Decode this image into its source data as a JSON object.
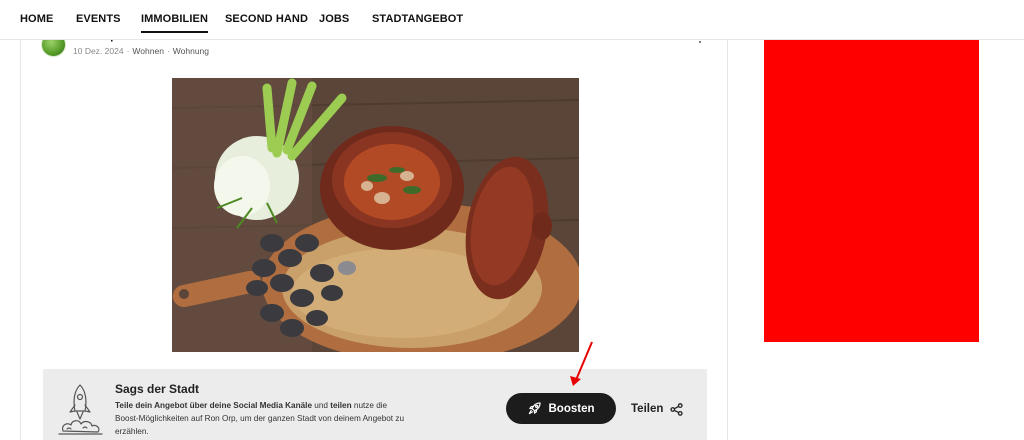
{
  "nav": {
    "items": [
      {
        "label": "HOME"
      },
      {
        "label": "EVENTS"
      },
      {
        "label": "IMMOBILIEN"
      },
      {
        "label": "SECOND HAND"
      },
      {
        "label": "JOBS"
      },
      {
        "label": "STADTANGEBOT"
      }
    ],
    "active": "IMMOBILIEN"
  },
  "post": {
    "author": "Ron Orp",
    "date": "10 Dez. 2024",
    "category": "Wohnen",
    "subcategory": "Wohnung"
  },
  "boost": {
    "title": "Sags der Stadt",
    "text_b1": "Teile dein Angebot über deine Social Media Kanäle",
    "text_1": " und ",
    "text_b2": "teilen",
    "text_2": " nutze die Boost-Möglichkeiten auf Ron Orp, um der ganzen Stadt von deinem Angebot zu erzählen.",
    "boost_button_label": "Boosten",
    "share_button_label": "Teilen"
  },
  "colors": {
    "boost_button": "#1c1c1c",
    "boost_bar": "#ececec",
    "ad_box": "#ff0000",
    "annotation_arrow": "#e60000"
  },
  "icons": {
    "boost_button_icon": "rocket-icon",
    "share_button_icon": "share-icon",
    "post_menu_icon": "kebab-menu-icon"
  }
}
